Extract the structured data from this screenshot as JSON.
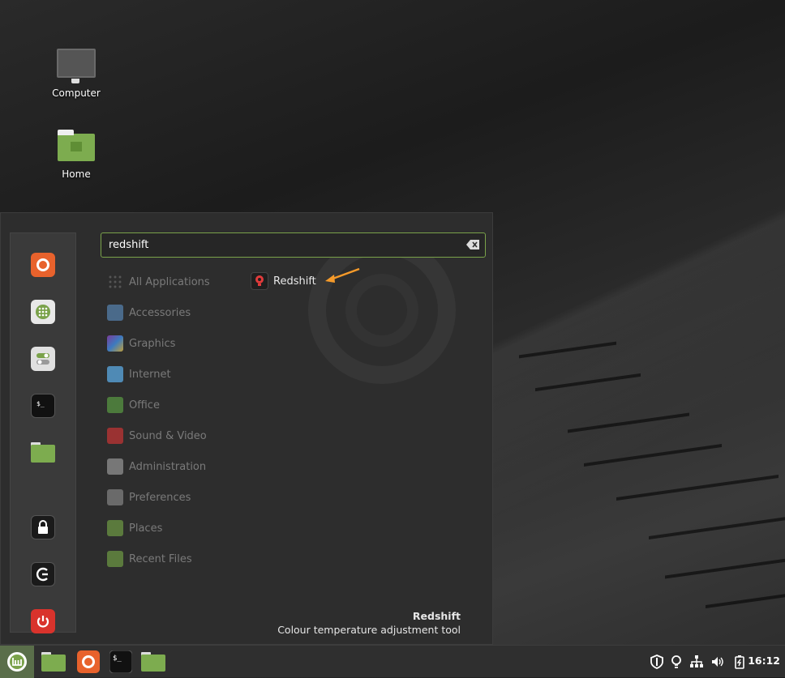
{
  "desktop": {
    "icons": [
      {
        "label": "Computer"
      },
      {
        "label": "Home"
      }
    ]
  },
  "menu": {
    "search": {
      "value": "redshift",
      "placeholder": ""
    },
    "categories": [
      {
        "label": "All Applications",
        "icon": "grid-icon"
      },
      {
        "label": "Accessories",
        "icon": "scissors-icon"
      },
      {
        "label": "Graphics",
        "icon": "palette-icon"
      },
      {
        "label": "Internet",
        "icon": "cloud-icon"
      },
      {
        "label": "Office",
        "icon": "document-icon"
      },
      {
        "label": "Sound & Video",
        "icon": "play-icon"
      },
      {
        "label": "Administration",
        "icon": "toggle-icon"
      },
      {
        "label": "Preferences",
        "icon": "settings-icon"
      },
      {
        "label": "Places",
        "icon": "folder-icon"
      },
      {
        "label": "Recent Files",
        "icon": "clock-folder-icon"
      }
    ],
    "result": {
      "label": "Redshift",
      "icon": "lightbulb-icon"
    },
    "description": {
      "title": "Redshift",
      "text": "Colour temperature adjustment tool"
    },
    "favorites": [
      "firefox-icon",
      "software-manager-icon",
      "settings-icon",
      "terminal-icon",
      "files-icon",
      "lock-icon",
      "logout-icon",
      "power-icon"
    ]
  },
  "panel": {
    "clock": "16:12",
    "launchers": [
      "files-icon",
      "firefox-icon",
      "terminal-icon",
      "files-icon"
    ],
    "tray": [
      "shield-icon",
      "redshift-bulb-icon",
      "network-icon",
      "volume-icon",
      "battery-icon"
    ]
  },
  "colors": {
    "accent": "#7aa24a",
    "menu_bg": "#2d2d2d",
    "panel_bg": "#2f2f2f"
  }
}
